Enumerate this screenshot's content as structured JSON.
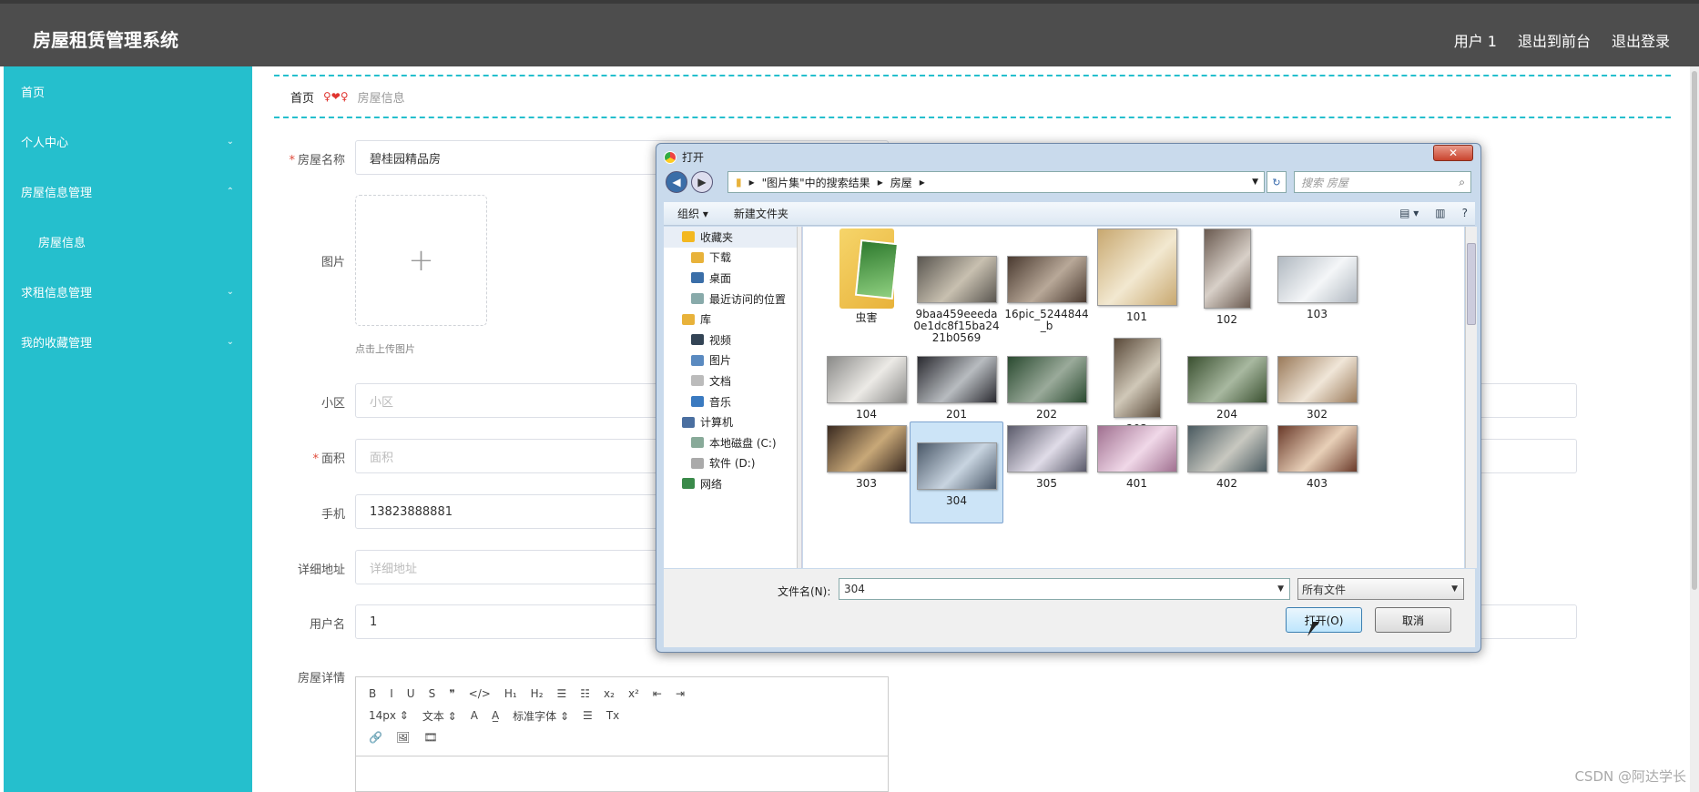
{
  "app": {
    "title": "房屋租赁管理系统"
  },
  "topnav": {
    "user": "用户 1",
    "front": "退出到前台",
    "logout": "退出登录"
  },
  "sidebar": {
    "items": [
      {
        "label": "首页",
        "chevron": ""
      },
      {
        "label": "个人中心",
        "chevron": "⌄"
      },
      {
        "label": "房屋信息管理",
        "chevron": "⌃"
      },
      {
        "label": "房屋信息",
        "chevron": "",
        "sub": true
      },
      {
        "label": "求租信息管理",
        "chevron": "⌄"
      },
      {
        "label": "我的收藏管理",
        "chevron": "⌄"
      }
    ]
  },
  "breadcrumb": {
    "home": "首页",
    "sep": "♀❤♀",
    "current": "房屋信息"
  },
  "form": {
    "name_label": "房屋名称",
    "name_value": "碧桂园精品房",
    "image_label": "图片",
    "upload_plus": "+",
    "upload_tip": "点击上传图片",
    "community_label": "小区",
    "community_placeholder": "小区",
    "area_label": "面积",
    "area_placeholder": "面积",
    "phone_label": "手机",
    "phone_value": "13823888881",
    "address_label": "详细地址",
    "address_placeholder": "详细地址",
    "username_label": "用户名",
    "username_value": "1",
    "detail_label": "房屋详情",
    "required_mark": "*"
  },
  "editor": {
    "row1": [
      "B",
      "I",
      "U",
      "S",
      "❞",
      "</>",
      "H₁",
      "H₂",
      "☰",
      "☷",
      "x₂",
      "x²",
      "⇤",
      "⇥"
    ],
    "row2": [
      "14px  ⇕",
      "文本  ⇕",
      "A",
      "A̲",
      "标准字体  ⇕",
      "☰",
      "Tx"
    ],
    "row3": [
      "🔗",
      "🖼",
      "🎞"
    ]
  },
  "dialog": {
    "title": "打开",
    "close": "✕",
    "path": [
      "▸",
      "\"图片集\"中的搜索结果",
      "▸",
      "房屋",
      "▸"
    ],
    "search_placeholder": "搜索 房屋",
    "cmd_organize": "组织 ▾",
    "cmd_newfolder": "新建文件夹",
    "tree": [
      {
        "label": "收藏夹",
        "icon": "star",
        "color": "#f3b820",
        "hl": true
      },
      {
        "label": "下载",
        "icon": "folder",
        "color": "#e8b23a",
        "sub": true
      },
      {
        "label": "桌面",
        "icon": "desktop",
        "color": "#3a6ea8",
        "sub": true
      },
      {
        "label": "最近访问的位置",
        "icon": "recent",
        "color": "#8aa",
        "sub": true
      },
      {
        "gap": true
      },
      {
        "label": "库",
        "icon": "library",
        "color": "#e8b23a"
      },
      {
        "label": "视频",
        "icon": "video",
        "color": "#345",
        "sub": true
      },
      {
        "label": "图片",
        "icon": "pictures",
        "color": "#5a8ac0",
        "sub": true
      },
      {
        "label": "文档",
        "icon": "documents",
        "color": "#bbb",
        "sub": true
      },
      {
        "label": "音乐",
        "icon": "music",
        "color": "#3a7ac0",
        "sub": true
      },
      {
        "gap": true
      },
      {
        "label": "计算机",
        "icon": "computer",
        "color": "#4a6fa0"
      },
      {
        "label": "本地磁盘 (C:)",
        "icon": "drive",
        "color": "#8a9",
        "sub": true
      },
      {
        "label": "软件 (D:)",
        "icon": "drive",
        "color": "#aaa",
        "sub": true
      },
      {
        "gap": true
      },
      {
        "label": "网络",
        "icon": "network",
        "color": "#3a8a4a"
      }
    ],
    "files": [
      {
        "name": "虫害",
        "type": "folder"
      },
      {
        "name": "9baa459eeeda0e1dc8f15ba2421b0569",
        "c1": "#5a5650",
        "c2": "#c8c0b0"
      },
      {
        "name": "16pic_5244844_b",
        "c1": "#4a3a30",
        "c2": "#b8a898"
      },
      {
        "name": "101",
        "c1": "#c8a870",
        "c2": "#f2e8d0"
      },
      {
        "name": "102",
        "c1": "#6a5a50",
        "c2": "#d8d0c8"
      },
      {
        "name": "103",
        "c1": "#b0b8c0",
        "c2": "#f4f6f8"
      },
      {
        "name": "104",
        "c1": "#8a8a88",
        "c2": "#eceae6"
      },
      {
        "name": "201",
        "c1": "#2a2a30",
        "c2": "#b8bcc0"
      },
      {
        "name": "202",
        "c1": "#2a4a30",
        "c2": "#9aaa9a"
      },
      {
        "name": "203",
        "c1": "#5a4a3a",
        "c2": "#d0c8b8"
      },
      {
        "name": "204",
        "c1": "#3a5030",
        "c2": "#a8b8a0"
      },
      {
        "name": "302",
        "c1": "#9a7a5a",
        "c2": "#f0e6d8"
      },
      {
        "name": "303",
        "c1": "#3a2a20",
        "c2": "#c8a878"
      },
      {
        "name": "304",
        "c1": "#4a5868",
        "c2": "#c8d4e0",
        "selected": true
      },
      {
        "name": "305",
        "c1": "#5a5a6a",
        "c2": "#e0dce8"
      },
      {
        "name": "401",
        "c1": "#a07090",
        "c2": "#f0d8e8"
      },
      {
        "name": "402",
        "c1": "#4a5a60",
        "c2": "#c8c8c0"
      },
      {
        "name": "403",
        "c1": "#6a3a2a",
        "c2": "#e8d0b8"
      }
    ],
    "filename_label": "文件名(N):",
    "filename_value": "304",
    "filetype_value": "所有文件",
    "open_button": "打开(O)",
    "cancel_button": "取消"
  },
  "watermark": "CSDN @阿达学长"
}
